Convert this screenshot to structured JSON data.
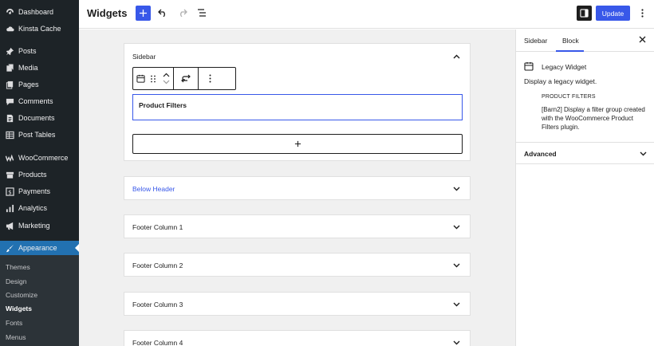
{
  "admin_menu": {
    "items": [
      {
        "label": "Dashboard",
        "icon": "dashboard-icon"
      },
      {
        "label": "Kinsta Cache",
        "icon": "cloud-icon"
      },
      {
        "label": "Posts",
        "icon": "pin-icon"
      },
      {
        "label": "Media",
        "icon": "media-icon"
      },
      {
        "label": "Pages",
        "icon": "pages-icon"
      },
      {
        "label": "Comments",
        "icon": "comment-icon"
      },
      {
        "label": "Documents",
        "icon": "document-icon"
      },
      {
        "label": "Post Tables",
        "icon": "table-icon"
      },
      {
        "label": "WooCommerce",
        "icon": "woo-icon"
      },
      {
        "label": "Products",
        "icon": "archive-icon"
      },
      {
        "label": "Payments",
        "icon": "payments-icon"
      },
      {
        "label": "Analytics",
        "icon": "chart-icon"
      },
      {
        "label": "Marketing",
        "icon": "megaphone-icon"
      },
      {
        "label": "Appearance",
        "icon": "brush-icon"
      }
    ],
    "submenu": [
      "Themes",
      "Design",
      "Customize",
      "Widgets",
      "Fonts",
      "Menus"
    ],
    "active_submenu": "Widgets"
  },
  "header": {
    "title": "Widgets",
    "update_label": "Update"
  },
  "widget_areas": {
    "sidebar": {
      "title": "Sidebar",
      "block_title": "Product Filters"
    },
    "others": [
      "Below Header",
      "Footer Column 1",
      "Footer Column 2",
      "Footer Column 3",
      "Footer Column 4"
    ]
  },
  "panel": {
    "tabs": [
      "Sidebar",
      "Block"
    ],
    "active_tab": "Block",
    "block_name": "Legacy Widget",
    "block_description": "Display a legacy widget.",
    "widget_label": "PRODUCT FILTERS",
    "widget_description": "[Barn2] Display a filter group created with the WooCommerce Product Filters plugin.",
    "advanced_label": "Advanced"
  },
  "colors": {
    "admin_bg": "#1d2327",
    "accent": "#3858e9",
    "current_menu": "#2271b1",
    "canvas_bg": "#f0f0f0"
  }
}
